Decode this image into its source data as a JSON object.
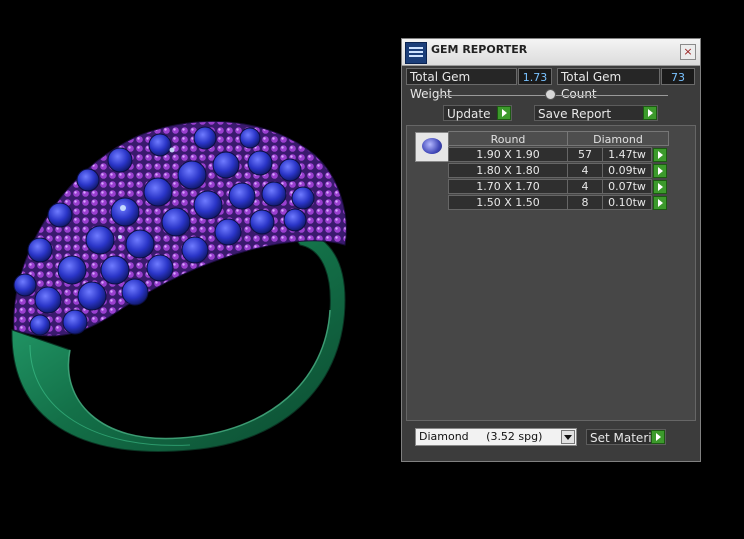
{
  "panel": {
    "title": "GEM REPORTER",
    "close_glyph": "×",
    "total_weight_label": "Total Gem Weight",
    "total_weight_value": "1.73",
    "total_count_label": "Total Gem Count",
    "total_count_value": "73",
    "update_label": "Update",
    "save_report_label": "Save Report",
    "table": {
      "shape_header": "Round",
      "material_header": "Diamond",
      "rows": [
        {
          "size": "1.90 X 1.90",
          "count": "57",
          "weight": "1.47tw"
        },
        {
          "size": "1.80 X 1.80",
          "count": "4",
          "weight": "0.09tw"
        },
        {
          "size": "1.70 X 1.70",
          "count": "4",
          "weight": "0.07tw"
        },
        {
          "size": "1.50 X 1.50",
          "count": "8",
          "weight": "0.10tw"
        }
      ]
    },
    "material_select_value": "Diamond     (3.52 spg)",
    "set_material_label": "Set Material"
  },
  "colors": {
    "ring_metal": "#1f8a5c",
    "gem_blue": "#2a35c8",
    "gem_purple": "#9a3fd0",
    "accent_value": "#79c2ff",
    "go_green": "#3c9a2c"
  },
  "icons": [
    "gem-reporter-app-icon",
    "close-icon",
    "play-arrow-icon",
    "dropdown-arrow-icon",
    "round-gem-icon"
  ]
}
